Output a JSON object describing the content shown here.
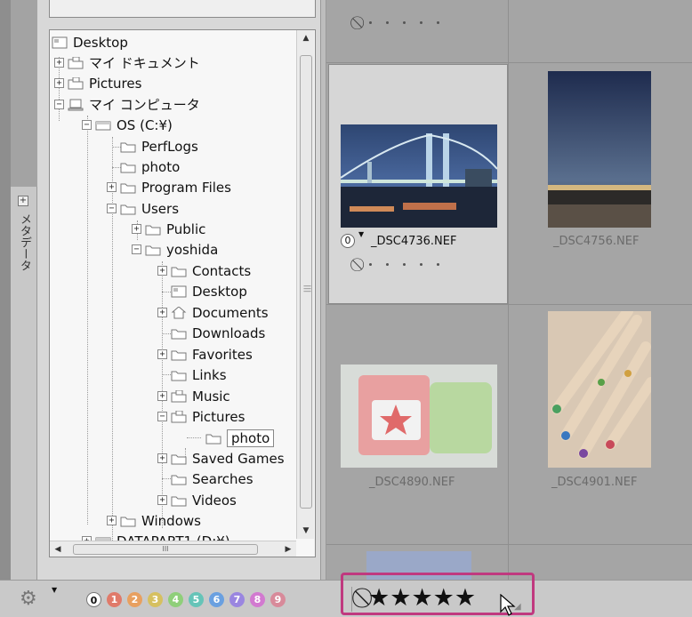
{
  "sidebar": {
    "metadata_tab_label": "メタデータ"
  },
  "tree": {
    "items": [
      {
        "label": "Desktop"
      },
      {
        "label": "マイ ドキュメント"
      },
      {
        "label": "Pictures"
      },
      {
        "label": "マイ コンピュータ"
      },
      {
        "label": "OS (C:¥)"
      },
      {
        "label": "PerfLogs"
      },
      {
        "label": "photo"
      },
      {
        "label": "Program Files"
      },
      {
        "label": "Users"
      },
      {
        "label": "Public"
      },
      {
        "label": "yoshida"
      },
      {
        "label": "Contacts"
      },
      {
        "label": "Desktop"
      },
      {
        "label": "Documents"
      },
      {
        "label": "Downloads"
      },
      {
        "label": "Favorites"
      },
      {
        "label": "Links"
      },
      {
        "label": "Music"
      },
      {
        "label": "Pictures"
      },
      {
        "label": "photo"
      },
      {
        "label": "Saved Games"
      },
      {
        "label": "Searches"
      },
      {
        "label": "Videos"
      },
      {
        "label": "Windows"
      },
      {
        "label": "DATAPART1 (D:¥)"
      }
    ],
    "hscroll_grip": "III"
  },
  "grid": {
    "files": [
      {
        "name": "_DSC4736.NEF",
        "rating_badge": "0"
      },
      {
        "name": "_DSC4756.NEF"
      },
      {
        "name": "_DSC4890.NEF"
      },
      {
        "name": "_DSC4901.NEF"
      }
    ]
  },
  "toolbar": {
    "label_numbers": [
      "0",
      "1",
      "2",
      "3",
      "4",
      "5",
      "6",
      "7",
      "8",
      "9"
    ],
    "label_colors": [
      "#ffffff",
      "#e07a6a",
      "#e8a060",
      "#d6c060",
      "#8fcf7a",
      "#66c4b8",
      "#6aa0e0",
      "#9a86e0",
      "#d27ad0",
      "#d88a9a"
    ]
  }
}
